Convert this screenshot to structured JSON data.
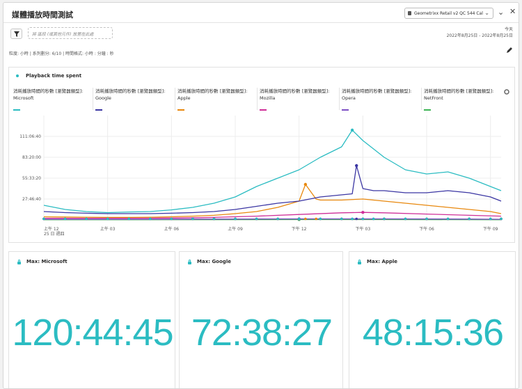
{
  "header": {
    "title": "媒體播放時間測試",
    "report_suite": "Geometrixx Retail v2 QC 544 Cal"
  },
  "toolbar": {
    "segment_placeholder": "將 區段 (或其他元件) 放置在此處",
    "date_label": "今天",
    "date_range": "2022年8月25日 - 2022年8月25日"
  },
  "meta_line": "粒度: 小時 | 系列劃分: 6/10 | 時間格式: 小時 : 分鐘 : 秒",
  "chart_card": {
    "title": "Playback time spent"
  },
  "legend": [
    {
      "line1": "消耗播放時間的秒數 [瀏覽器類型]:",
      "line2": "Microsoft",
      "color": "#2bbcc2"
    },
    {
      "line1": "消耗播放時間的秒數 [瀏覽器類型]:",
      "line2": "Google",
      "color": "#3b36a3"
    },
    {
      "line1": "消耗播放時間的秒數 [瀏覽器類型]:",
      "line2": "Apple",
      "color": "#e8880e"
    },
    {
      "line1": "消耗播放時間的秒數 [瀏覽器類型]:",
      "line2": "Mozilla",
      "color": "#cf2e98"
    },
    {
      "line1": "消耗播放時間的秒數 [瀏覽器類型]:",
      "line2": "Opera",
      "color": "#7d4fc4"
    },
    {
      "line1": "消耗播放時間的秒數 [瀏覽器類型]:",
      "line2": "NetFront",
      "color": "#3cb454"
    }
  ],
  "chart_data": {
    "type": "line",
    "y_ticks": [
      "27:46:40",
      "55:33:20",
      "83:20:00",
      "111:06:40"
    ],
    "y_ticks_seconds": [
      100000,
      200000,
      300000,
      400000
    ],
    "ylim_seconds": [
      0,
      500000
    ],
    "x_ticks": [
      "上午 12",
      "上午 03",
      "上午 06",
      "上午 09",
      "下午 12",
      "下午 03",
      "下午 06",
      "下午 09"
    ],
    "x_ticks_hours": [
      0,
      3,
      6,
      9,
      12,
      15,
      18,
      21
    ],
    "x_first_sub": "25 日 週四",
    "xlim_hours": [
      0,
      21.5
    ],
    "grid": true,
    "series": [
      {
        "name": "消耗播放時間的秒數 [瀏覽器類型]: Microsoft",
        "color": "#2bbcc2",
        "x": [
          0,
          1,
          2,
          3,
          4,
          5,
          6,
          7,
          8,
          9,
          10,
          11,
          12,
          13,
          14,
          14.5,
          15,
          15.5,
          16,
          17,
          18,
          19,
          20,
          21,
          21.5
        ],
        "y": [
          70000,
          50000,
          40000,
          35000,
          38000,
          40000,
          48000,
          60000,
          80000,
          110000,
          160000,
          200000,
          240000,
          300000,
          350000,
          430000,
          380000,
          340000,
          300000,
          240000,
          220000,
          230000,
          200000,
          160000,
          140000
        ]
      },
      {
        "name": "消耗播放時間的秒數 [瀏覽器類型]: Google",
        "color": "#3b36a3",
        "x": [
          0,
          1,
          2,
          3,
          4,
          5,
          6,
          7,
          8,
          9,
          10,
          11,
          12,
          13,
          14,
          14.5,
          14.7,
          15,
          15.5,
          16,
          17,
          18,
          19,
          20,
          21,
          21.5
        ],
        "y": [
          40000,
          35000,
          32000,
          30000,
          30000,
          30000,
          32000,
          35000,
          40000,
          50000,
          65000,
          80000,
          90000,
          110000,
          120000,
          125000,
          260000,
          150000,
          140000,
          140000,
          130000,
          130000,
          140000,
          130000,
          110000,
          90000
        ]
      },
      {
        "name": "消耗播放時間的秒數 [瀏覽器類型]: Apple",
        "color": "#e8880e",
        "x": [
          0,
          1,
          2,
          3,
          4,
          5,
          6,
          7,
          8,
          9,
          10,
          11,
          12,
          12.3,
          12.8,
          13,
          14,
          15,
          16,
          17,
          18,
          19,
          20,
          21,
          21.5
        ],
        "y": [
          15000,
          14000,
          13000,
          12000,
          12000,
          13000,
          15000,
          18000,
          22000,
          30000,
          40000,
          60000,
          90000,
          170000,
          100000,
          95000,
          95000,
          100000,
          90000,
          80000,
          70000,
          60000,
          50000,
          40000,
          30000
        ]
      },
      {
        "name": "消耗播放時間的秒數 [瀏覽器類型]: Mozilla",
        "color": "#cf2e98",
        "x": [
          0,
          2,
          4,
          6,
          8,
          10,
          12,
          14,
          15,
          16,
          18,
          20,
          21.5
        ],
        "y": [
          8000,
          8000,
          8000,
          9000,
          12000,
          18000,
          26000,
          34000,
          36000,
          34000,
          28000,
          22000,
          18000
        ]
      },
      {
        "name": "消耗播放時間的秒數 [瀏覽器類型]: Opera",
        "color": "#7d4fc4",
        "x": [
          0,
          4,
          8,
          12,
          16,
          20,
          21.5
        ],
        "y": [
          3000,
          3000,
          4000,
          5000,
          5000,
          4000,
          3000
        ]
      },
      {
        "name": "消耗播放時間的秒數 [瀏覽器類型]: NetFront",
        "color": "#3cb454",
        "x": [
          0,
          4,
          8,
          12,
          16,
          20,
          21.5
        ],
        "y": [
          1000,
          1000,
          1500,
          2000,
          2000,
          1500,
          1000
        ]
      }
    ]
  },
  "summary_cards": [
    {
      "title": "Max: Microsoft",
      "value": "120:44:45"
    },
    {
      "title": "Max: Google",
      "value": "72:38:27"
    },
    {
      "title": "Max: Apple",
      "value": "48:15:36"
    }
  ],
  "colors": {
    "accent": "#2bbcc2"
  },
  "icons": [
    "filter-icon",
    "database-icon",
    "chevron-down-icon",
    "close-icon",
    "pencil-icon",
    "lock-icon",
    "settings-icon"
  ]
}
